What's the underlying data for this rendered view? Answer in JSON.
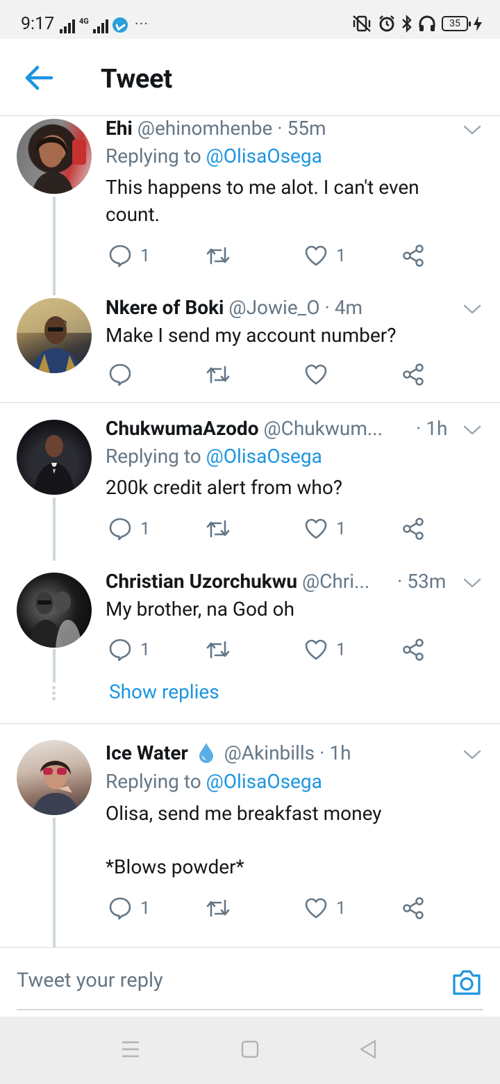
{
  "status_bar": {
    "time": "9:17",
    "network": "4G",
    "more": "···",
    "battery": "35"
  },
  "header": {
    "title": "Tweet"
  },
  "tweets": [
    {
      "name": "Ehi",
      "handle": "@ehinomhenbe",
      "time": "· 55m",
      "replying_prefix": "Replying to ",
      "replying_to": "@OlisaOsega",
      "text": "This happens to me alot. I can't even count.",
      "reply_count": "1",
      "like_count": "1"
    },
    {
      "name": "Nkere of Boki",
      "handle": "@Jowie_O",
      "time": "· 4m",
      "text": "Make I send my account number?",
      "reply_count": "",
      "like_count": ""
    },
    {
      "name": "ChukwumaAzodo",
      "handle": "@Chukwum...",
      "time": "· 1h",
      "replying_prefix": "Replying to ",
      "replying_to": "@OlisaOsega",
      "text": "200k credit alert from who?",
      "reply_count": "1",
      "like_count": "1"
    },
    {
      "name": "Christian Uzorchukwu",
      "handle": "@Chri...",
      "time": "· 53m",
      "text": "My brother, na God oh",
      "reply_count": "1",
      "like_count": "1",
      "show_replies": "Show replies"
    },
    {
      "name": "Ice Water",
      "name_emoji": "droplet-icon",
      "handle": "@Akinbills",
      "time": "· 1h",
      "replying_prefix": "Replying to ",
      "replying_to": "@OlisaOsega",
      "text_line1": "Olisa, send me breakfast money",
      "text_line2": "*Blows powder*",
      "reply_count": "1",
      "like_count": "1"
    }
  ],
  "composer": {
    "placeholder": "Tweet your reply"
  },
  "colors": {
    "accent": "#1b95e0",
    "secondary_text": "#657786",
    "divider": "#d6dbe0",
    "thread_line": "#ccd6dd"
  }
}
